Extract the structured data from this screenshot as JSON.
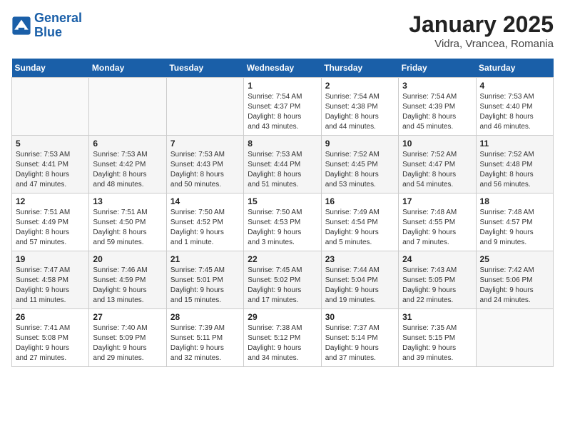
{
  "header": {
    "logo_line1": "General",
    "logo_line2": "Blue",
    "title": "January 2025",
    "subtitle": "Vidra, Vrancea, Romania"
  },
  "days_of_week": [
    "Sunday",
    "Monday",
    "Tuesday",
    "Wednesday",
    "Thursday",
    "Friday",
    "Saturday"
  ],
  "weeks": [
    [
      {
        "day": "",
        "info": ""
      },
      {
        "day": "",
        "info": ""
      },
      {
        "day": "",
        "info": ""
      },
      {
        "day": "1",
        "info": "Sunrise: 7:54 AM\nSunset: 4:37 PM\nDaylight: 8 hours\nand 43 minutes."
      },
      {
        "day": "2",
        "info": "Sunrise: 7:54 AM\nSunset: 4:38 PM\nDaylight: 8 hours\nand 44 minutes."
      },
      {
        "day": "3",
        "info": "Sunrise: 7:54 AM\nSunset: 4:39 PM\nDaylight: 8 hours\nand 45 minutes."
      },
      {
        "day": "4",
        "info": "Sunrise: 7:53 AM\nSunset: 4:40 PM\nDaylight: 8 hours\nand 46 minutes."
      }
    ],
    [
      {
        "day": "5",
        "info": "Sunrise: 7:53 AM\nSunset: 4:41 PM\nDaylight: 8 hours\nand 47 minutes."
      },
      {
        "day": "6",
        "info": "Sunrise: 7:53 AM\nSunset: 4:42 PM\nDaylight: 8 hours\nand 48 minutes."
      },
      {
        "day": "7",
        "info": "Sunrise: 7:53 AM\nSunset: 4:43 PM\nDaylight: 8 hours\nand 50 minutes."
      },
      {
        "day": "8",
        "info": "Sunrise: 7:53 AM\nSunset: 4:44 PM\nDaylight: 8 hours\nand 51 minutes."
      },
      {
        "day": "9",
        "info": "Sunrise: 7:52 AM\nSunset: 4:45 PM\nDaylight: 8 hours\nand 53 minutes."
      },
      {
        "day": "10",
        "info": "Sunrise: 7:52 AM\nSunset: 4:47 PM\nDaylight: 8 hours\nand 54 minutes."
      },
      {
        "day": "11",
        "info": "Sunrise: 7:52 AM\nSunset: 4:48 PM\nDaylight: 8 hours\nand 56 minutes."
      }
    ],
    [
      {
        "day": "12",
        "info": "Sunrise: 7:51 AM\nSunset: 4:49 PM\nDaylight: 8 hours\nand 57 minutes."
      },
      {
        "day": "13",
        "info": "Sunrise: 7:51 AM\nSunset: 4:50 PM\nDaylight: 8 hours\nand 59 minutes."
      },
      {
        "day": "14",
        "info": "Sunrise: 7:50 AM\nSunset: 4:52 PM\nDaylight: 9 hours\nand 1 minute."
      },
      {
        "day": "15",
        "info": "Sunrise: 7:50 AM\nSunset: 4:53 PM\nDaylight: 9 hours\nand 3 minutes."
      },
      {
        "day": "16",
        "info": "Sunrise: 7:49 AM\nSunset: 4:54 PM\nDaylight: 9 hours\nand 5 minutes."
      },
      {
        "day": "17",
        "info": "Sunrise: 7:48 AM\nSunset: 4:55 PM\nDaylight: 9 hours\nand 7 minutes."
      },
      {
        "day": "18",
        "info": "Sunrise: 7:48 AM\nSunset: 4:57 PM\nDaylight: 9 hours\nand 9 minutes."
      }
    ],
    [
      {
        "day": "19",
        "info": "Sunrise: 7:47 AM\nSunset: 4:58 PM\nDaylight: 9 hours\nand 11 minutes."
      },
      {
        "day": "20",
        "info": "Sunrise: 7:46 AM\nSunset: 4:59 PM\nDaylight: 9 hours\nand 13 minutes."
      },
      {
        "day": "21",
        "info": "Sunrise: 7:45 AM\nSunset: 5:01 PM\nDaylight: 9 hours\nand 15 minutes."
      },
      {
        "day": "22",
        "info": "Sunrise: 7:45 AM\nSunset: 5:02 PM\nDaylight: 9 hours\nand 17 minutes."
      },
      {
        "day": "23",
        "info": "Sunrise: 7:44 AM\nSunset: 5:04 PM\nDaylight: 9 hours\nand 19 minutes."
      },
      {
        "day": "24",
        "info": "Sunrise: 7:43 AM\nSunset: 5:05 PM\nDaylight: 9 hours\nand 22 minutes."
      },
      {
        "day": "25",
        "info": "Sunrise: 7:42 AM\nSunset: 5:06 PM\nDaylight: 9 hours\nand 24 minutes."
      }
    ],
    [
      {
        "day": "26",
        "info": "Sunrise: 7:41 AM\nSunset: 5:08 PM\nDaylight: 9 hours\nand 27 minutes."
      },
      {
        "day": "27",
        "info": "Sunrise: 7:40 AM\nSunset: 5:09 PM\nDaylight: 9 hours\nand 29 minutes."
      },
      {
        "day": "28",
        "info": "Sunrise: 7:39 AM\nSunset: 5:11 PM\nDaylight: 9 hours\nand 32 minutes."
      },
      {
        "day": "29",
        "info": "Sunrise: 7:38 AM\nSunset: 5:12 PM\nDaylight: 9 hours\nand 34 minutes."
      },
      {
        "day": "30",
        "info": "Sunrise: 7:37 AM\nSunset: 5:14 PM\nDaylight: 9 hours\nand 37 minutes."
      },
      {
        "day": "31",
        "info": "Sunrise: 7:35 AM\nSunset: 5:15 PM\nDaylight: 9 hours\nand 39 minutes."
      },
      {
        "day": "",
        "info": ""
      }
    ]
  ]
}
